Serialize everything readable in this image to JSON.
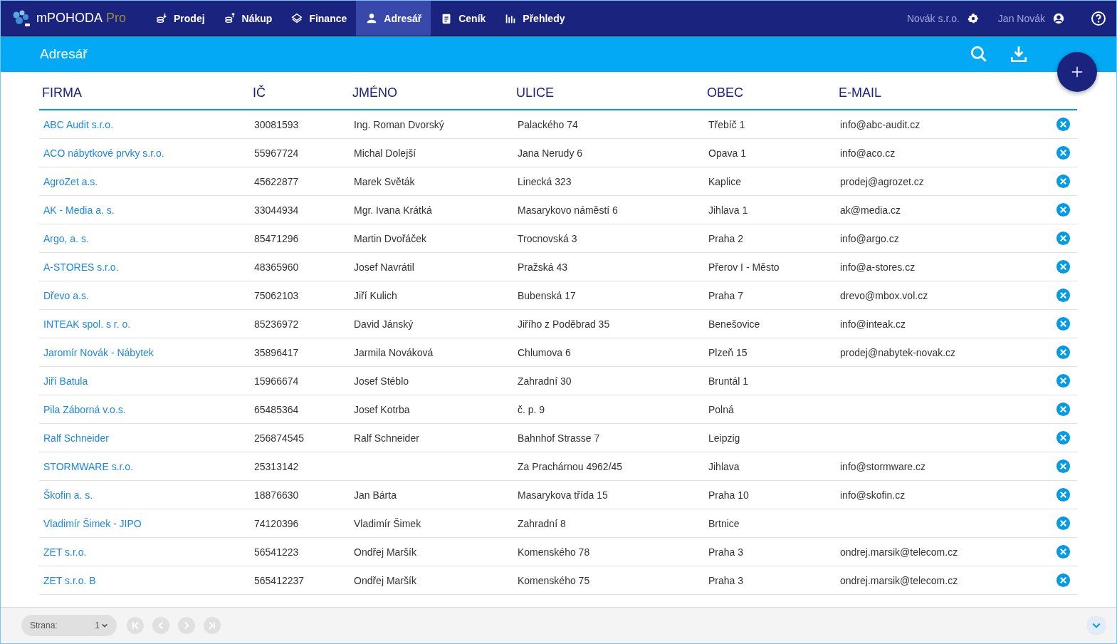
{
  "app": {
    "name": "mPOHODA",
    "edition": "Pro"
  },
  "nav": [
    {
      "label": "Prodej",
      "selected": false
    },
    {
      "label": "Nákup",
      "selected": false
    },
    {
      "label": "Finance",
      "selected": false
    },
    {
      "label": "Adresář",
      "selected": true
    },
    {
      "label": "Ceník",
      "selected": false
    },
    {
      "label": "Přehledy",
      "selected": false
    }
  ],
  "company": "Novák s.r.o.",
  "user": "Jan Novák",
  "page_title": "Adresář",
  "table": {
    "columns": [
      "FIRMA",
      "IČ",
      "JMÉNO",
      "ULICE",
      "OBEC",
      "E-MAIL"
    ],
    "rows": [
      [
        "ABC Audit s.r.o.",
        "30081593",
        "Ing. Roman Dvorský",
        "Palackého 74",
        "Třebíč 1",
        "info@abc-audit.cz"
      ],
      [
        "ACO nábytkové prvky s.r.o.",
        "55967724",
        "Michal Dolejší",
        "Jana Nerudy 6",
        "Opava 1",
        "info@aco.cz"
      ],
      [
        "AgroZet a.s.",
        "45622877",
        "Marek Světák",
        "Linecká 323",
        "Kaplice",
        "prodej@agrozet.cz"
      ],
      [
        "AK - Media a. s.",
        "33044934",
        "Mgr. Ivana Krátká",
        "Masarykovo náměstí 6",
        "Jihlava 1",
        "ak@media.cz"
      ],
      [
        "Argo, a. s.",
        "85471296",
        "Martin Dvořáček",
        "Trocnovská 3",
        "Praha 2",
        "info@argo.cz"
      ],
      [
        "A-STORES s.r.o.",
        "48365960",
        "Josef Navrátil",
        "Pražská 43",
        "Přerov I - Město",
        "info@a-stores.cz"
      ],
      [
        "Dřevo a.s.",
        "75062103",
        "Jiří Kulich",
        "Bubenská 17",
        "Praha 7",
        "drevo@mbox.vol.cz"
      ],
      [
        "INTEAK spol. s r. o.",
        "85236972",
        "David Jánský",
        "Jiřího z Poděbrad 35",
        "Benešovice",
        "info@inteak.cz"
      ],
      [
        "Jaromír Novák - Nábytek",
        "35896417",
        "Jarmila Nováková",
        "Chlumova 6",
        "Plzeň 15",
        "prodej@nabytek-novak.cz"
      ],
      [
        "Jiří Batula",
        "15966674",
        "Josef Stéblo",
        "Zahradní 30",
        "Bruntál 1",
        ""
      ],
      [
        "Pila Záborná v.o.s.",
        "65485364",
        "Josef Kotrba",
        "č. p. 9",
        "Polná",
        ""
      ],
      [
        "Ralf Schneider",
        "256874545",
        "Ralf Schneider",
        "Bahnhof Strasse 7",
        "Leipzig",
        ""
      ],
      [
        "STORMWARE s.r.o.",
        "25313142",
        "",
        "Za Prachárnou 4962/45",
        "Jihlava",
        "info@stormware.cz"
      ],
      [
        "Škofin a. s.",
        "18876630",
        "Jan Bárta",
        "Masarykova třída 15",
        "Praha 10",
        "info@skofin.cz"
      ],
      [
        "Vladimír Šimek - JIPO",
        "74120396",
        "Vladimír Šimek",
        "Zahradní 8",
        "Brtnice",
        ""
      ],
      [
        "ZET s.r.o.",
        "56541223",
        "Ondřej Maršík",
        "Komenského 78",
        "Praha 3",
        "ondrej.marsik@telecom.cz"
      ],
      [
        "ZET s.r.o. B",
        "565412237",
        "Ondřej Maršík",
        "Komenského 75",
        "Praha 3",
        "ondrej.marsik@telecom.cz"
      ]
    ]
  },
  "pager": {
    "label": "Strana:",
    "page": "1",
    "buttons": [
      {
        "disabled": true
      },
      {
        "disabled": true
      },
      {
        "disabled": true
      },
      {
        "disabled": true
      }
    ]
  }
}
